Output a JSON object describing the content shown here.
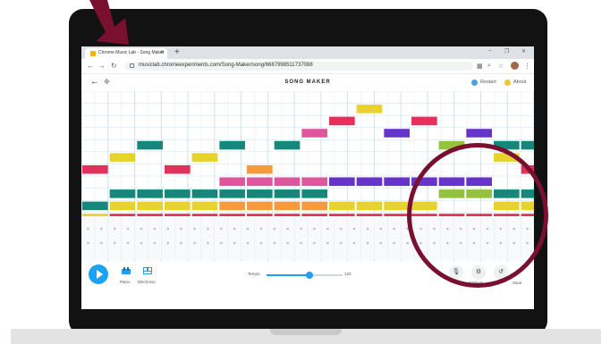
{
  "browser": {
    "tab_title": "Chrome Music Lab - Song Maker",
    "url": "musiclab.chromeexperiments.com/Song-Maker/song/6687998511737088"
  },
  "app": {
    "title": "SONG MAKER",
    "restart_label": "Restart",
    "about_label": "About",
    "restart_color": "#4aa3df",
    "about_color": "#f4c430"
  },
  "bottom_bar": {
    "instrument1_label": "Piano",
    "instrument2_label": "Electronic",
    "tempo_label": "Tempo",
    "tempo_value": "120",
    "tempo_fraction": 0.56,
    "settings_label": "Settings",
    "save_label": "Save"
  },
  "grid": {
    "cols": 16,
    "rows": 14,
    "colors": {
      "red": "#e5305c",
      "yellow": "#e8d22e",
      "teal": "#16877a",
      "orange": "#f59a3f",
      "pink": "#e0559d",
      "purple": "#6633cc",
      "green": "#93c23c"
    },
    "notes": [
      {
        "col": 0,
        "row": 10,
        "color": "yellow"
      },
      {
        "col": 0,
        "row": 9,
        "color": "teal"
      },
      {
        "col": 0,
        "row": 6,
        "color": "red"
      },
      {
        "col": 1,
        "row": 10,
        "color": "red"
      },
      {
        "col": 1,
        "row": 9,
        "color": "yellow"
      },
      {
        "col": 1,
        "row": 8,
        "color": "teal"
      },
      {
        "col": 1,
        "row": 5,
        "color": "yellow"
      },
      {
        "col": 2,
        "row": 10,
        "color": "red"
      },
      {
        "col": 2,
        "row": 9,
        "color": "yellow"
      },
      {
        "col": 2,
        "row": 8,
        "color": "teal"
      },
      {
        "col": 2,
        "row": 4,
        "color": "teal"
      },
      {
        "col": 3,
        "row": 10,
        "color": "red"
      },
      {
        "col": 3,
        "row": 9,
        "color": "yellow"
      },
      {
        "col": 3,
        "row": 8,
        "color": "teal"
      },
      {
        "col": 3,
        "row": 6,
        "color": "red"
      },
      {
        "col": 4,
        "row": 10,
        "color": "red"
      },
      {
        "col": 4,
        "row": 9,
        "color": "yellow"
      },
      {
        "col": 4,
        "row": 8,
        "color": "teal"
      },
      {
        "col": 4,
        "row": 5,
        "color": "yellow"
      },
      {
        "col": 5,
        "row": 10,
        "color": "red"
      },
      {
        "col": 5,
        "row": 9,
        "color": "orange"
      },
      {
        "col": 5,
        "row": 8,
        "color": "teal"
      },
      {
        "col": 5,
        "row": 7,
        "color": "pink"
      },
      {
        "col": 5,
        "row": 4,
        "color": "teal"
      },
      {
        "col": 6,
        "row": 10,
        "color": "red"
      },
      {
        "col": 6,
        "row": 9,
        "color": "orange"
      },
      {
        "col": 6,
        "row": 8,
        "color": "teal"
      },
      {
        "col": 6,
        "row": 7,
        "color": "pink"
      },
      {
        "col": 6,
        "row": 6,
        "color": "orange"
      },
      {
        "col": 7,
        "row": 10,
        "color": "red"
      },
      {
        "col": 7,
        "row": 9,
        "color": "orange"
      },
      {
        "col": 7,
        "row": 8,
        "color": "teal"
      },
      {
        "col": 7,
        "row": 7,
        "color": "pink"
      },
      {
        "col": 7,
        "row": 4,
        "color": "teal"
      },
      {
        "col": 8,
        "row": 10,
        "color": "red"
      },
      {
        "col": 8,
        "row": 9,
        "color": "orange"
      },
      {
        "col": 8,
        "row": 8,
        "color": "teal"
      },
      {
        "col": 8,
        "row": 7,
        "color": "pink"
      },
      {
        "col": 8,
        "row": 3,
        "color": "pink"
      },
      {
        "col": 9,
        "row": 10,
        "color": "red"
      },
      {
        "col": 9,
        "row": 9,
        "color": "yellow"
      },
      {
        "col": 9,
        "row": 7,
        "color": "purple"
      },
      {
        "col": 9,
        "row": 2,
        "color": "red"
      },
      {
        "col": 10,
        "row": 10,
        "color": "red"
      },
      {
        "col": 10,
        "row": 9,
        "color": "yellow"
      },
      {
        "col": 10,
        "row": 7,
        "color": "purple"
      },
      {
        "col": 10,
        "row": 1,
        "color": "yellow"
      },
      {
        "col": 11,
        "row": 10,
        "color": "red"
      },
      {
        "col": 11,
        "row": 9,
        "color": "yellow"
      },
      {
        "col": 11,
        "row": 7,
        "color": "purple"
      },
      {
        "col": 11,
        "row": 3,
        "color": "purple"
      },
      {
        "col": 12,
        "row": 10,
        "color": "red"
      },
      {
        "col": 12,
        "row": 9,
        "color": "yellow"
      },
      {
        "col": 12,
        "row": 7,
        "color": "purple"
      },
      {
        "col": 12,
        "row": 2,
        "color": "red"
      },
      {
        "col": 13,
        "row": 10,
        "color": "red"
      },
      {
        "col": 13,
        "row": 8,
        "color": "green"
      },
      {
        "col": 13,
        "row": 7,
        "color": "purple"
      },
      {
        "col": 13,
        "row": 4,
        "color": "green"
      },
      {
        "col": 14,
        "row": 10,
        "color": "red"
      },
      {
        "col": 14,
        "row": 8,
        "color": "green"
      },
      {
        "col": 14,
        "row": 7,
        "color": "purple"
      },
      {
        "col": 14,
        "row": 3,
        "color": "purple"
      },
      {
        "col": 15,
        "row": 10,
        "color": "red"
      },
      {
        "col": 15,
        "row": 9,
        "color": "yellow"
      },
      {
        "col": 15,
        "row": 8,
        "color": "teal"
      },
      {
        "col": 15,
        "row": 5,
        "color": "yellow"
      },
      {
        "col": 15,
        "row": 4,
        "color": "teal"
      },
      {
        "col": 16,
        "row": 10,
        "color": "red"
      },
      {
        "col": 16,
        "row": 9,
        "color": "yellow"
      },
      {
        "col": 16,
        "row": 8,
        "color": "teal"
      },
      {
        "col": 16,
        "row": 6,
        "color": "red"
      },
      {
        "col": 16,
        "row": 4,
        "color": "teal"
      }
    ]
  }
}
